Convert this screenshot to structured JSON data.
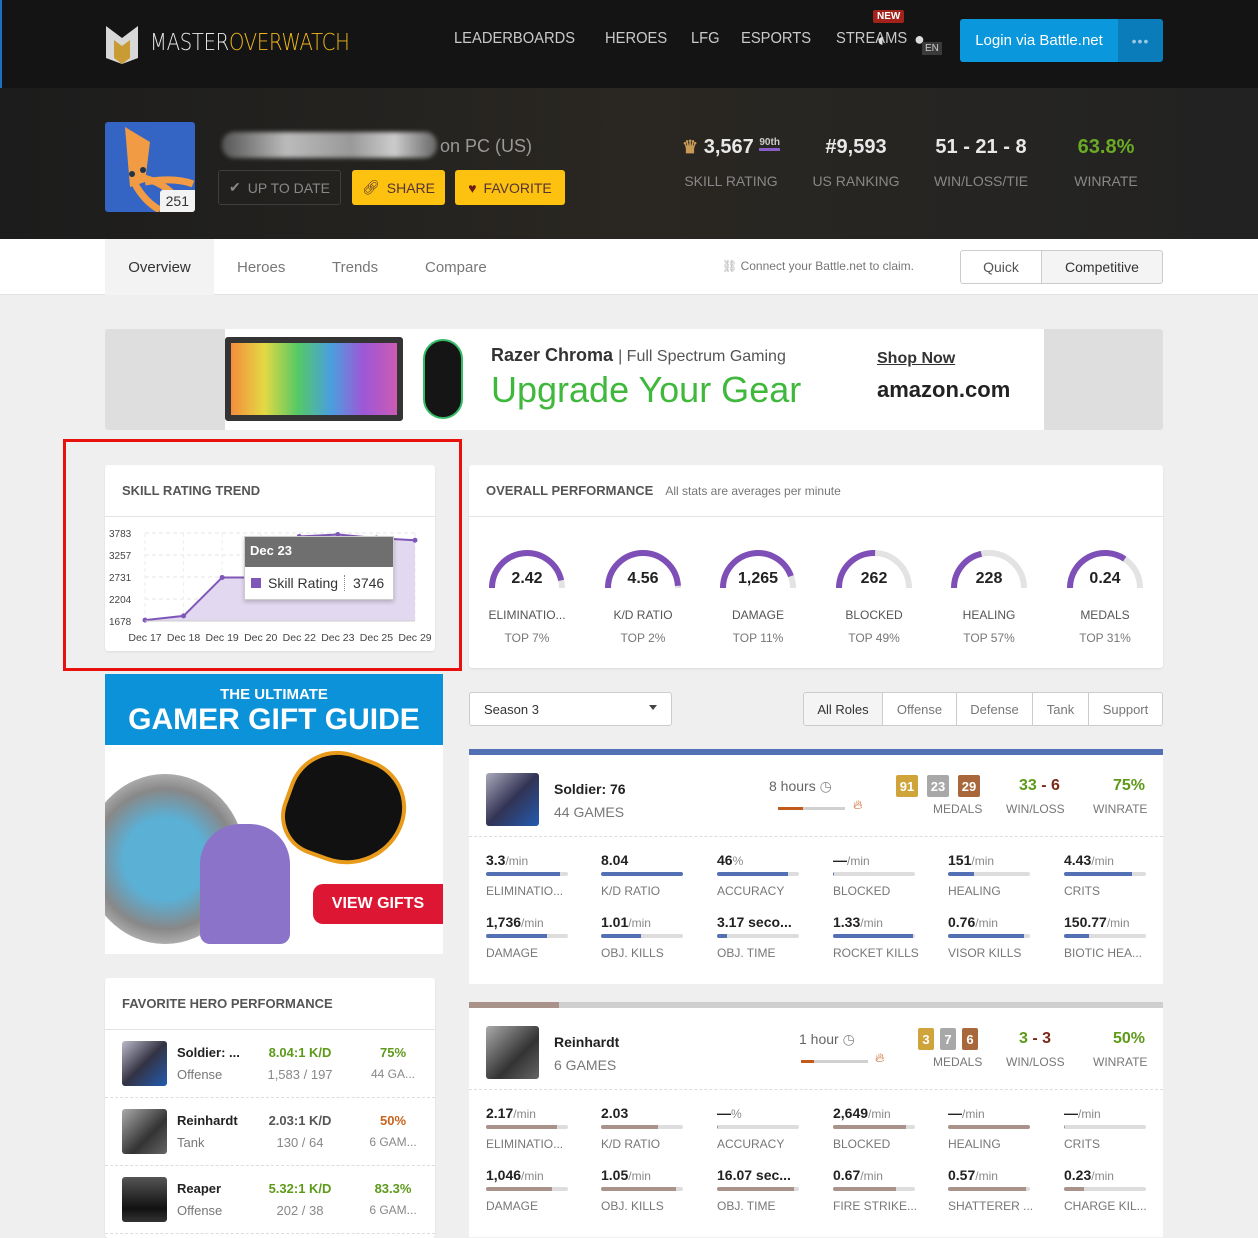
{
  "nav": {
    "brand_a": "MASTER",
    "brand_b": "OVERWATCH",
    "links": [
      "LEADERBOARDS",
      "HEROES",
      "LFG",
      "ESPORTS",
      "STREAMS"
    ],
    "new_badge": "NEW",
    "lang": "EN",
    "login": "Login via Battle.net",
    "more": "•••",
    "icons": [
      "contrast-icon",
      "globe-icon"
    ]
  },
  "profile": {
    "level": "251",
    "platform": "on PC (US)",
    "buttons": {
      "up_to_date": "UP TO DATE",
      "share": "SHARE",
      "favorite": "FAVORITE"
    },
    "stats": [
      {
        "value": "3,567",
        "sup": "90th",
        "label": "SKILL RATING"
      },
      {
        "value": "#9,593",
        "label": "US RANKING"
      },
      {
        "value": "51 - 21 - 8",
        "label": "WIN/LOSS/TIE"
      },
      {
        "value": "63.8%",
        "label": "WINRATE"
      }
    ]
  },
  "tabs": [
    "Overview",
    "Heroes",
    "Trends",
    "Compare"
  ],
  "claim": "Connect your Battle.net to claim.",
  "modes": [
    "Quick",
    "Competitive"
  ],
  "ad_top": {
    "brand": "Razer Chroma",
    "tagline": "Full Spectrum Gaming",
    "headline": "Upgrade Your Gear",
    "shop": "Shop Now",
    "store": "amazon.com"
  },
  "ad_side": {
    "line1": "THE ULTIMATE",
    "line2": "GAMER GIFT GUIDE",
    "cta": "VIEW GIFTS"
  },
  "sr_trend": {
    "title": "SKILL RATING TREND",
    "tooltip": {
      "date": "Dec 23",
      "series": "Skill Rating",
      "value": "3746"
    }
  },
  "chart_data": {
    "type": "area",
    "title": "SKILL RATING TREND",
    "categories": [
      "Dec 17",
      "Dec 18",
      "Dec 19",
      "Dec 20",
      "Dec 22",
      "Dec 23",
      "Dec 25",
      "Dec 29"
    ],
    "series": [
      {
        "name": "Skill Rating",
        "values": [
          1700,
          1800,
          2720,
          2720,
          3700,
          3746,
          3660,
          3610
        ]
      }
    ],
    "yticks": [
      1678,
      2204,
      2731,
      3257,
      3783
    ],
    "ylim": [
      1678,
      3783
    ],
    "grid": true,
    "color": "#7e57b8"
  },
  "overall": {
    "title": "OVERALL PERFORMANCE",
    "subtitle": "All stats are averages per minute",
    "gauges": [
      {
        "value": "2.42",
        "label": "ELIMINATIO...",
        "top": "TOP 7%",
        "pct": 0.93
      },
      {
        "value": "4.56",
        "label": "K/D RATIO",
        "top": "TOP 2%",
        "pct": 0.98
      },
      {
        "value": "1,265",
        "label": "DAMAGE",
        "top": "TOP 11%",
        "pct": 0.89
      },
      {
        "value": "262",
        "label": "BLOCKED",
        "top": "TOP 49%",
        "pct": 0.51
      },
      {
        "value": "228",
        "label": "HEALING",
        "top": "TOP 57%",
        "pct": 0.43
      },
      {
        "value": "0.24",
        "label": "MEDALS",
        "top": "TOP 31%",
        "pct": 0.69
      }
    ]
  },
  "filters": {
    "season": "Season 3",
    "roles": [
      "All Roles",
      "Offense",
      "Defense",
      "Tank",
      "Support"
    ]
  },
  "heroes": [
    {
      "name": "Soldier: 76",
      "games": "44 GAMES",
      "time": "8 hours",
      "time_pct": 0.38,
      "medals": [
        "91",
        "23",
        "29"
      ],
      "medals_label": "MEDALS",
      "wins": "33",
      "losses": "6",
      "wl_label": "WIN/LOSS",
      "winrate": "75%",
      "wr_label": "WINRATE",
      "accent": "#5470b5",
      "stats": [
        {
          "v": "3.3",
          "u": "/min",
          "l": "ELIMINATIO...",
          "p": 0.9
        },
        {
          "v": "8.04",
          "u": "",
          "l": "K/D RATIO",
          "p": 1.0
        },
        {
          "v": "46",
          "u": "%",
          "l": "ACCURACY",
          "p": 0.87
        },
        {
          "v": "—",
          "u": "/min",
          "l": "BLOCKED",
          "p": 0.01
        },
        {
          "v": "151",
          "u": "/min",
          "l": "HEALING",
          "p": 0.32
        },
        {
          "v": "4.43",
          "u": "/min",
          "l": "CRITS",
          "p": 0.83
        },
        {
          "v": "1,736",
          "u": "/min",
          "l": "DAMAGE",
          "p": 0.74
        },
        {
          "v": "1.01",
          "u": "/min",
          "l": "OBJ. KILLS",
          "p": 0.49
        },
        {
          "v": "3.17 seco...",
          "u": "",
          "l": "OBJ. TIME",
          "p": 0.12
        },
        {
          "v": "1.33",
          "u": "/min",
          "l": "ROCKET KILLS",
          "p": 0.97
        },
        {
          "v": "0.76",
          "u": "/min",
          "l": "VISOR KILLS",
          "p": 0.93
        },
        {
          "v": "150.77",
          "u": "/min",
          "l": "BIOTIC HEA...",
          "p": 0.31
        }
      ]
    },
    {
      "name": "Reinhardt",
      "games": "6 GAMES",
      "time": "1 hour",
      "time_pct": 0.2,
      "medals": [
        "3",
        "7",
        "6"
      ],
      "medals_label": "MEDALS",
      "wins": "3",
      "losses": "3",
      "wl_label": "WIN/LOSS",
      "winrate": "50%",
      "wr_label": "WINRATE",
      "accent": "#a8928a",
      "stats": [
        {
          "v": "2.17",
          "u": "/min",
          "l": "ELIMINATIO...",
          "p": 0.86
        },
        {
          "v": "2.03",
          "u": "",
          "l": "K/D RATIO",
          "p": 0.69
        },
        {
          "v": "—",
          "u": "%",
          "l": "ACCURACY",
          "p": 0.01
        },
        {
          "v": "2,649",
          "u": "/min",
          "l": "BLOCKED",
          "p": 0.89
        },
        {
          "v": "—",
          "u": "/min",
          "l": "HEALING",
          "p": 1.0
        },
        {
          "v": "—",
          "u": "/min",
          "l": "CRITS",
          "p": 0.01
        },
        {
          "v": "1,046",
          "u": "/min",
          "l": "DAMAGE",
          "p": 0.8
        },
        {
          "v": "1.05",
          "u": "/min",
          "l": "OBJ. KILLS",
          "p": 0.92
        },
        {
          "v": "16.07 sec...",
          "u": "",
          "l": "OBJ. TIME",
          "p": 0.94
        },
        {
          "v": "0.67",
          "u": "/min",
          "l": "FIRE STRIKE...",
          "p": 0.77
        },
        {
          "v": "0.57",
          "u": "/min",
          "l": "SHATTERER ...",
          "p": 0.95
        },
        {
          "v": "0.23",
          "u": "/min",
          "l": "CHARGE KIL...",
          "p": 0.24
        }
      ]
    }
  ],
  "favorites": {
    "title": "FAVORITE HERO PERFORMANCE",
    "rows": [
      {
        "name": "Soldier: ...",
        "role": "Offense",
        "kd": "8.04:1 K/D",
        "ks": "1,583 / 197",
        "wr": "75%",
        "games": "44 GA...",
        "kd_color": "#5e9a1a",
        "wr_color": "#5e9a1a"
      },
      {
        "name": "Reinhardt",
        "role": "Tank",
        "kd": "2.03:1 K/D",
        "ks": "130 / 64",
        "wr": "50%",
        "games": "6 GAM...",
        "kd_color": "#555555",
        "wr_color": "#c8641e"
      },
      {
        "name": "Reaper",
        "role": "Offense",
        "kd": "5.32:1 K/D",
        "ks": "202 / 38",
        "wr": "83.3%",
        "games": "6 GAM...",
        "kd_color": "#5e9a1a",
        "wr_color": "#5e9a1a"
      }
    ]
  }
}
